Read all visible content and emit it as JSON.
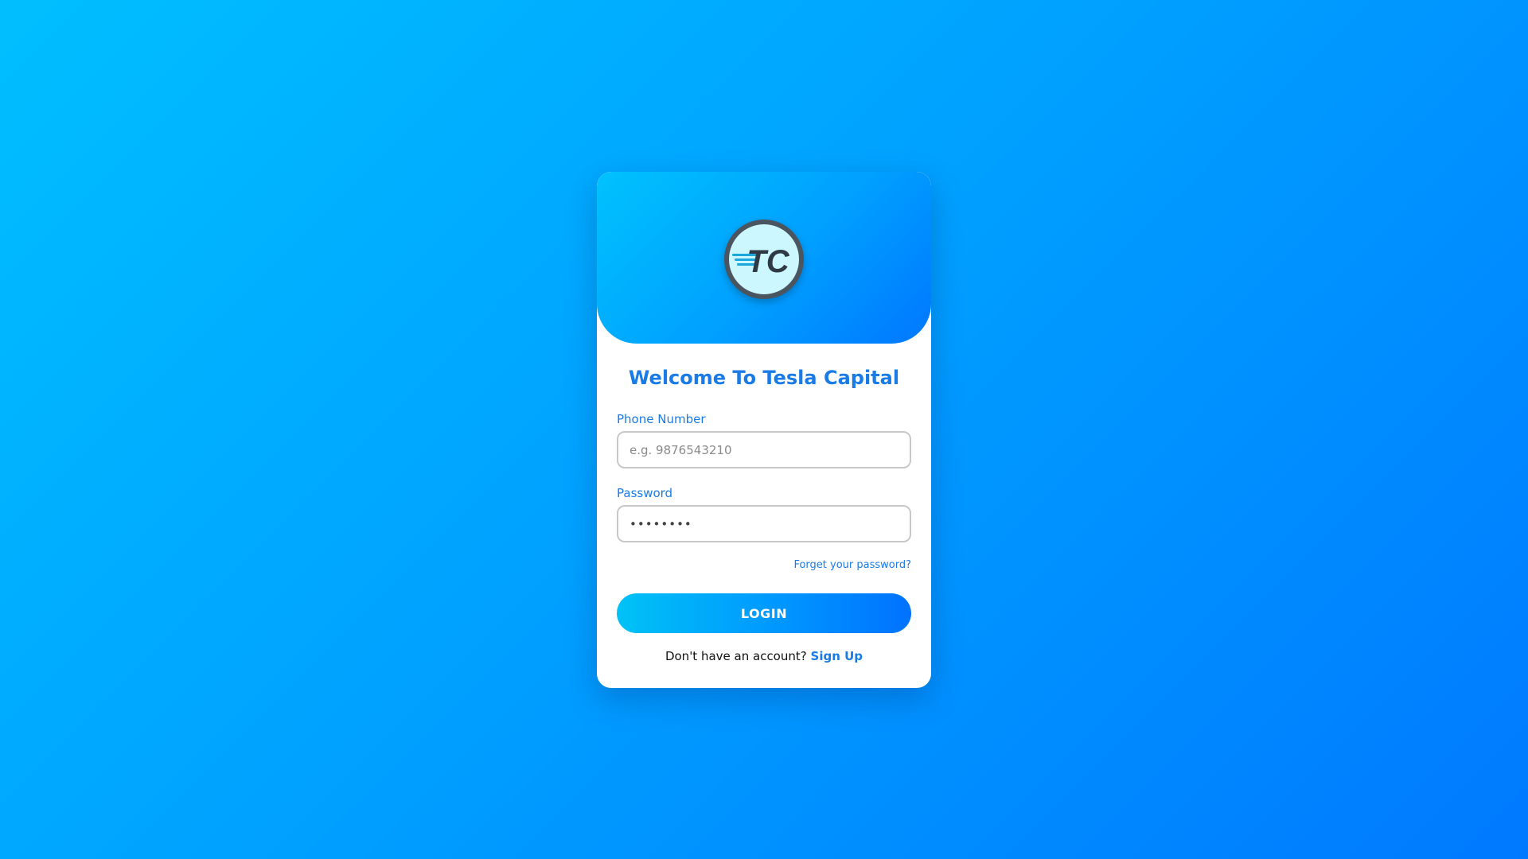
{
  "brand": {
    "logo_icon": "tc-logo-icon",
    "logo_text": "TC",
    "accent_color": "#1a7be6",
    "header_gradient": [
      "#00c2fd",
      "#0077ff"
    ]
  },
  "login": {
    "title": "Welcome To Tesla Capital",
    "phone": {
      "label": "Phone Number",
      "placeholder": "e.g. 9876543210",
      "value": ""
    },
    "password": {
      "label": "Password",
      "value": "••••••••"
    },
    "forgot_label": "Forget your password?",
    "submit_label": "LOGIN",
    "signup_prompt": "Don't have an account?",
    "signup_label": "Sign Up"
  }
}
